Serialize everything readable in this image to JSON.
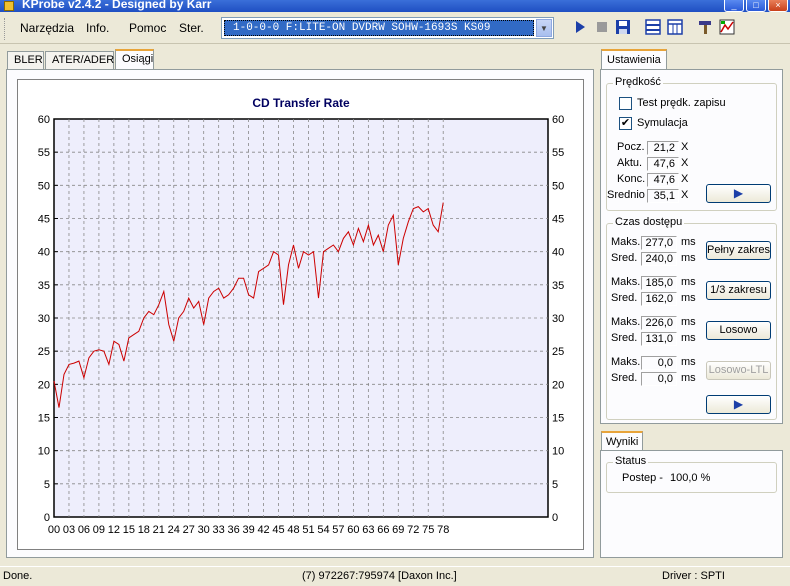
{
  "window": {
    "title": "KProbe v2.4.2 - Designed by Karr"
  },
  "menu": {
    "items": [
      "Narzędzia",
      "Info.",
      "Pomoc",
      "Ster."
    ]
  },
  "drive": {
    "selected": "1-0-0-0 F:LITE-ON DVDRW SOHW-1693S KS09"
  },
  "tabs": [
    "BLER",
    "ATER/ADER",
    "Osiągi"
  ],
  "chart_data": {
    "type": "line",
    "title": "CD Transfer Rate",
    "xlabel": "",
    "ylabel": "",
    "ylim": [
      0,
      60
    ],
    "xlim": [
      0,
      99
    ],
    "x_tick_labels": [
      "00",
      "03",
      "06",
      "09",
      "12",
      "15",
      "18",
      "21",
      "24",
      "27",
      "30",
      "33",
      "36",
      "39",
      "42",
      "45",
      "48",
      "51",
      "54",
      "57",
      "60",
      "63",
      "66",
      "69",
      "72",
      "75",
      "78"
    ],
    "y_tick_labels": [
      "0",
      "5",
      "10",
      "15",
      "20",
      "25",
      "30",
      "35",
      "40",
      "45",
      "50",
      "55",
      "60"
    ],
    "grid": true,
    "series": [
      {
        "color": "#cc0000",
        "x": [
          0,
          1,
          2,
          3,
          4,
          5,
          6,
          7,
          8,
          9,
          10,
          11,
          12,
          13,
          14,
          15,
          16,
          17,
          18,
          19,
          20,
          21,
          22,
          23,
          24,
          25,
          26,
          27,
          28,
          29,
          30,
          31,
          32,
          33,
          34,
          35,
          36,
          37,
          38,
          39,
          40,
          41,
          42,
          43,
          44,
          45,
          46,
          47,
          48,
          49,
          50,
          51,
          52,
          53,
          54,
          55,
          56,
          57,
          58,
          59,
          60,
          61,
          62,
          63,
          64,
          65,
          66,
          67,
          68,
          69,
          70,
          71,
          72,
          73,
          74,
          75,
          76,
          77,
          78
        ],
        "y": [
          20.5,
          16.5,
          21.5,
          23,
          23.2,
          23.5,
          21,
          24,
          25,
          25.2,
          25,
          23,
          26.5,
          26,
          23.5,
          27,
          27.5,
          28,
          30,
          31,
          30.5,
          32,
          34,
          29,
          26.5,
          30,
          31,
          33,
          31.5,
          32.5,
          29,
          33,
          34,
          34.5,
          33,
          33.5,
          34.5,
          36,
          36,
          33.5,
          33,
          37,
          37.5,
          38,
          40,
          39.5,
          32,
          38,
          41,
          37.5,
          40,
          39.5,
          40,
          33,
          40,
          40.5,
          41,
          40,
          42,
          43,
          41,
          43.5,
          41.5,
          44,
          41,
          42.5,
          40,
          44,
          45.5,
          38,
          42,
          44.5,
          46.5,
          46.8,
          46,
          46.5,
          44,
          43,
          47.4
        ]
      }
    ]
  },
  "settings": {
    "tab": "Ustawienia",
    "speed": {
      "label": "Prędkość",
      "test_label": "Test prędk. zapisu",
      "sim_label": "Symulacja",
      "rows": [
        {
          "label": "Pocz.",
          "value": "21,2",
          "unit": "X"
        },
        {
          "label": "Aktu.",
          "value": "47,6",
          "unit": "X"
        },
        {
          "label": "Konc.",
          "value": "47,6",
          "unit": "X"
        },
        {
          "label": "Srednio",
          "value": "35,1",
          "unit": "X"
        }
      ]
    },
    "access": {
      "label": "Czas dostępu",
      "groups": [
        {
          "maks": "277,0",
          "sred": "240,0",
          "button": "Pełny zakres"
        },
        {
          "maks": "185,0",
          "sred": "162,0",
          "button": "1/3 zakresu"
        },
        {
          "maks": "226,0",
          "sred": "131,0",
          "button": "Losowo"
        },
        {
          "maks": "0,0",
          "sred": "0,0",
          "button": "Losowo-LTL"
        }
      ],
      "maks_label": "Maks.",
      "sred_label": "Sred.",
      "unit": "ms"
    }
  },
  "results": {
    "tab": "Wyniki",
    "status_label": "Status",
    "progress_label": "Postep -",
    "progress_value": "100,0 %"
  },
  "statusbar": {
    "left": "Done.",
    "center": "(7) 972267:795974 [Daxon Inc.]",
    "right": "Driver : SPTI"
  }
}
